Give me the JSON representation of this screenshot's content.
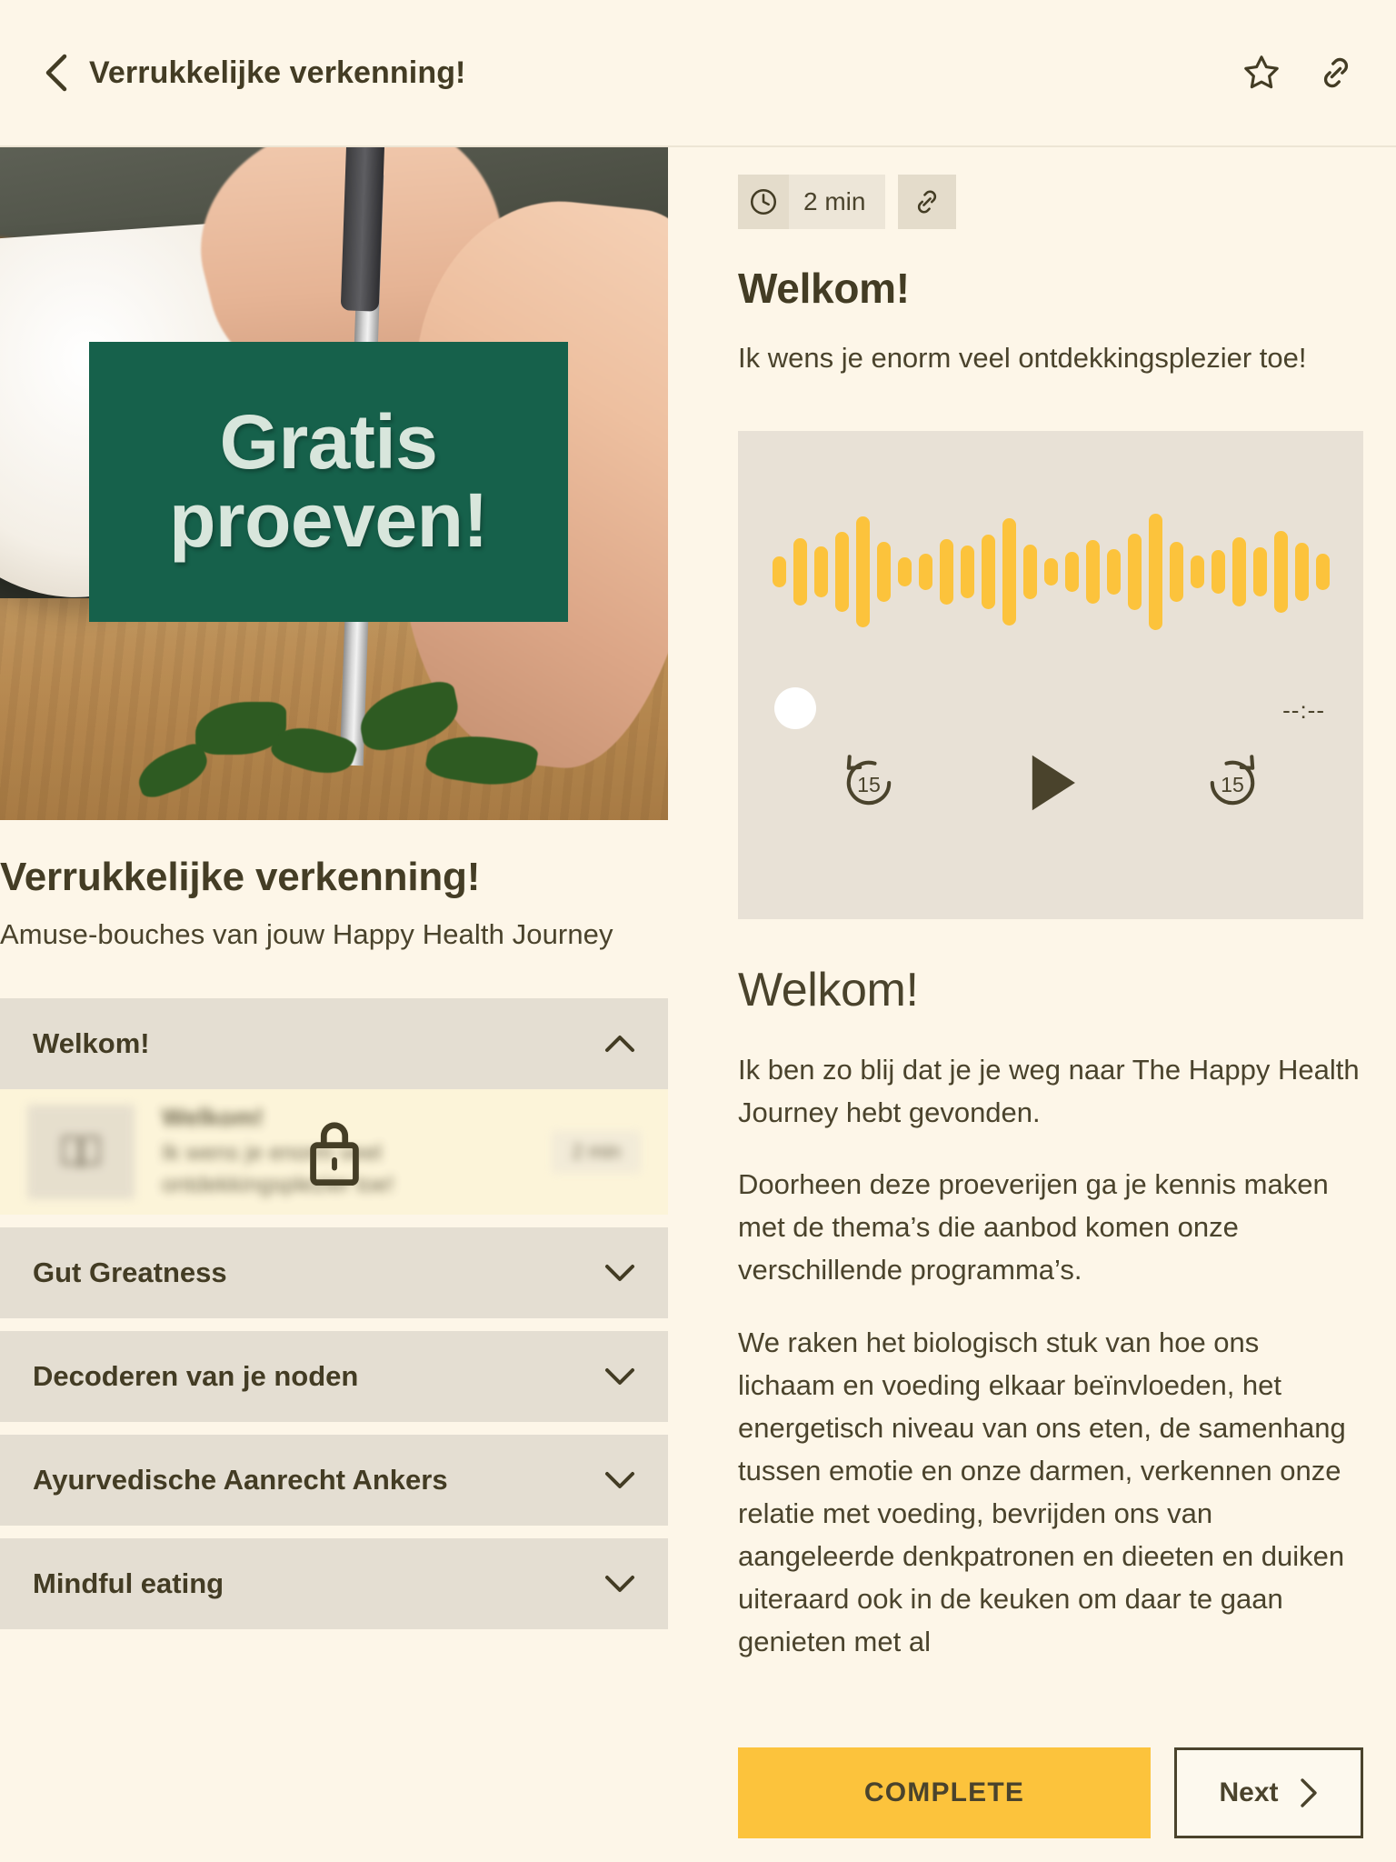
{
  "header": {
    "title": "Verrukkelijke verkenning!",
    "back_icon": "chevron-left-icon",
    "favorite_icon": "star-icon",
    "share_icon": "link-icon"
  },
  "hero": {
    "banner_line1": "Gratis",
    "banner_line2": "proeven!",
    "banner_color": "#16614B"
  },
  "course": {
    "title": "Verrukkelijke verkenning!",
    "subtitle": "Amuse-bouches van jouw Happy Health Journey"
  },
  "accordion": {
    "sections": [
      {
        "label": "Welkom!",
        "expanded": true,
        "chevron": "chevron-up-icon"
      },
      {
        "label": "Gut Greatness",
        "expanded": false,
        "chevron": "chevron-down-icon"
      },
      {
        "label": "Decoderen van je noden",
        "expanded": false,
        "chevron": "chevron-down-icon"
      },
      {
        "label": "Ayurvedische Aanrecht Ankers",
        "expanded": false,
        "chevron": "chevron-down-icon"
      },
      {
        "label": "Mindful eating",
        "expanded": false,
        "chevron": "chevron-down-icon"
      }
    ],
    "locked_lesson": {
      "title": "Welkom!",
      "description": "Ik wens je enorm veel ontdekkingsplezier toe!",
      "duration": "2 min",
      "thumb_icon": "book-icon",
      "lock_icon": "lock-icon",
      "locked": true
    }
  },
  "lesson": {
    "duration": "2 min",
    "clock_icon": "clock-icon",
    "link_icon": "link-icon",
    "title": "Welkom!",
    "intro": "Ik wens je enorm veel ontdekkingsplezier toe!"
  },
  "player": {
    "time_remaining": "--:--",
    "rewind_label": "15",
    "forward_label": "15",
    "rewind_icon": "rewind-15-icon",
    "play_icon": "play-icon",
    "forward_icon": "forward-15-icon",
    "scrubber_icon": "scrubber-handle",
    "waveform_color": "#FCC33C",
    "waveform_bars": [
      34,
      74,
      56,
      88,
      122,
      66,
      32,
      40,
      72,
      58,
      82,
      118,
      60,
      30,
      44,
      70,
      50,
      84,
      128,
      66,
      36,
      48,
      76,
      54,
      90,
      64,
      40
    ]
  },
  "article": {
    "heading": "Welkom!",
    "paragraphs": [
      "Ik ben zo blij dat je je weg naar The Happy Health Journey hebt gevonden.",
      "Doorheen deze proeverijen ga je kennis maken met de thema’s die aanbod komen onze verschillende programma’s.",
      "We raken het biologisch stuk van hoe ons lichaam en voeding elkaar beïnvloeden, het energetisch niveau van ons eten, de samenhang tussen emotie en onze darmen, verkennen onze relatie met voeding, bevrijden ons van aangeleerde denkpatronen en dieeten en duiken uiteraard ook in de keuken om daar te gaan genieten met al"
    ]
  },
  "actions": {
    "complete_label": "COMPLETE",
    "next_label": "Next",
    "next_icon": "chevron-right-icon",
    "complete_color": "#FCC33C"
  }
}
